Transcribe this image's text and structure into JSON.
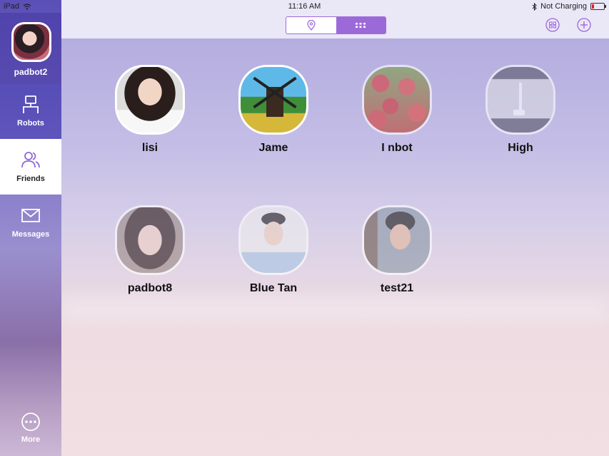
{
  "status_bar": {
    "device": "iPad",
    "time": "11:16 AM",
    "charging": "Not Charging"
  },
  "sidebar": {
    "profile_name": "padbot2",
    "items": [
      {
        "label": "Robots",
        "icon": "robot-icon"
      },
      {
        "label": "Friends",
        "icon": "friends-icon"
      },
      {
        "label": "Messages",
        "icon": "envelope-icon"
      },
      {
        "label": "More",
        "icon": "more-icon"
      }
    ],
    "selected": "Friends"
  },
  "topbar": {
    "view_options": [
      {
        "icon": "location-pin-icon",
        "active": false
      },
      {
        "icon": "grid-icon",
        "active": true
      }
    ],
    "actions": [
      {
        "icon": "qr-code-icon"
      },
      {
        "icon": "add-icon"
      }
    ]
  },
  "colors": {
    "accent": "#9c6ad8",
    "sidebar": "#5a4fb7"
  },
  "friends": [
    {
      "name": "lisi"
    },
    {
      "name": "Jame"
    },
    {
      "name": "I nbot"
    },
    {
      "name": "High"
    },
    {
      "name": "padbot8"
    },
    {
      "name": "Blue Tan"
    },
    {
      "name": "test21"
    }
  ]
}
